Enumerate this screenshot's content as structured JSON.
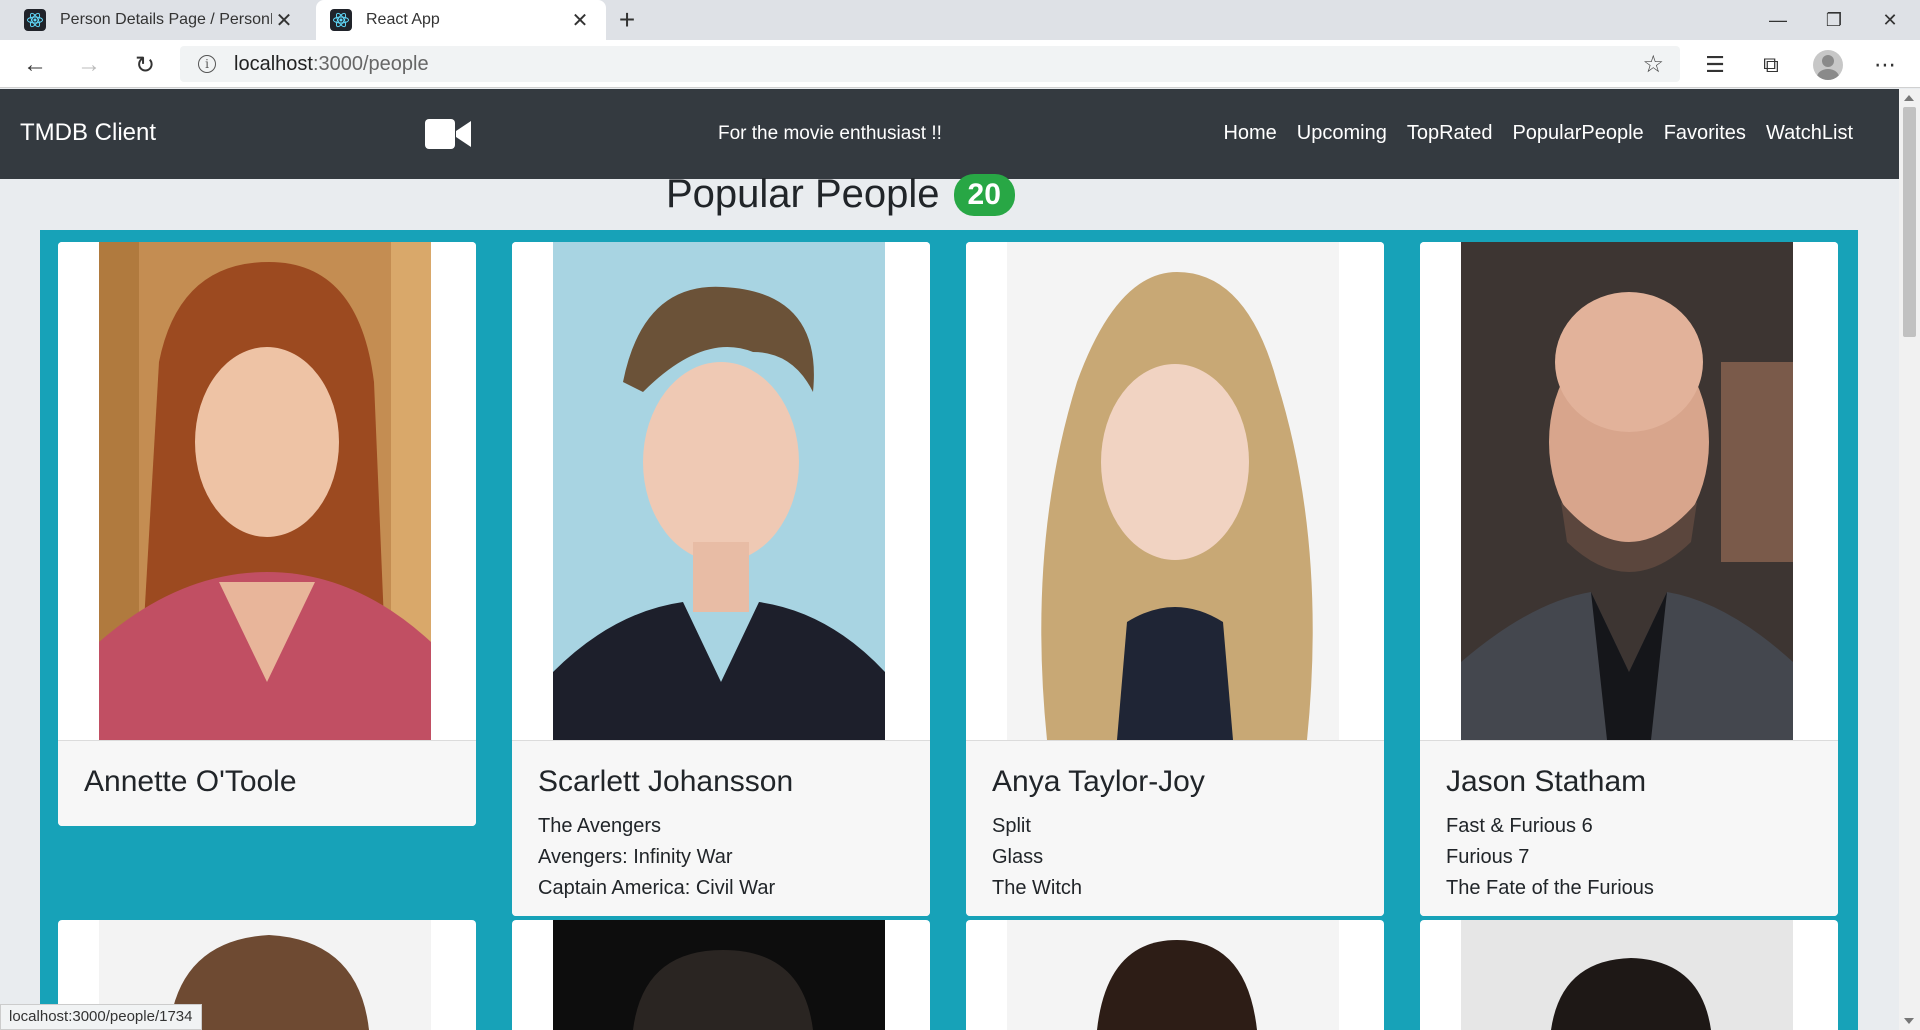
{
  "browser": {
    "tabs": [
      {
        "title": "Person Details Page / PersonHea",
        "active": false
      },
      {
        "title": "React App",
        "active": true
      }
    ],
    "url_host": "localhost",
    "url_path": ":3000/people",
    "status_url": "localhost:3000/people/1734"
  },
  "nav": {
    "brand": "TMDB Client",
    "tagline": "For the movie enthusiast !!",
    "links": [
      "Home",
      "Upcoming",
      "TopRated",
      "PopularPeople",
      "Favorites",
      "WatchList"
    ]
  },
  "page": {
    "title": "Popular People",
    "count": "20"
  },
  "people": [
    {
      "name": "Annette O'Toole",
      "films": []
    },
    {
      "name": "Scarlett Johansson",
      "films": [
        "The Avengers",
        "Avengers: Infinity War",
        "Captain America: Civil War"
      ]
    },
    {
      "name": "Anya Taylor-Joy",
      "films": [
        "Split",
        "Glass",
        "The Witch"
      ]
    },
    {
      "name": "Jason Statham",
      "films": [
        "Fast & Furious 6",
        "Furious 7",
        "The Fate of the Furious"
      ]
    }
  ],
  "colors": {
    "navbar": "#343a40",
    "grid_background": "#17a2b8",
    "badge": "#28a745"
  }
}
